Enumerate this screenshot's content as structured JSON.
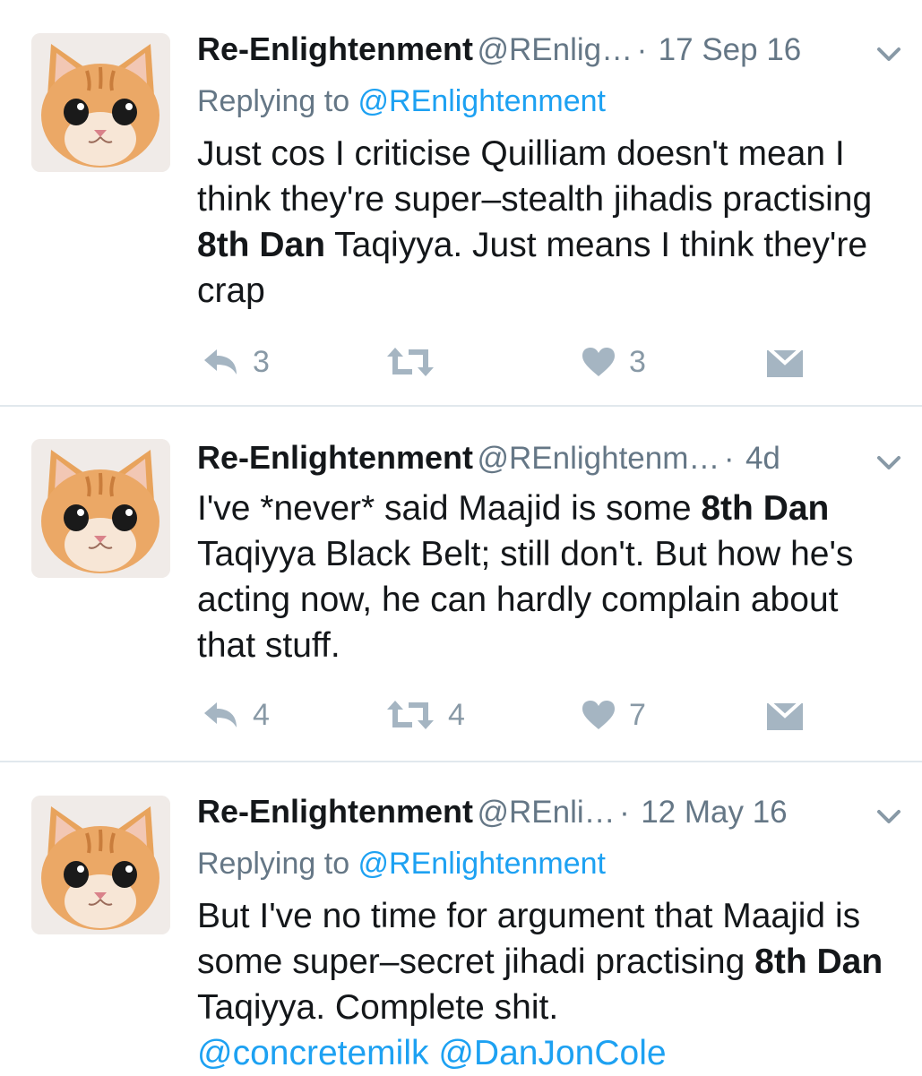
{
  "tweets": [
    {
      "name": "Re-Enlightenment",
      "handle": "@REnlig…",
      "dot": "·",
      "time": "17 Sep 16",
      "replying_prefix": "Replying to ",
      "replying_handle": "@REnlightenment",
      "text": {
        "part1": "Just cos I criticise Quilliam doesn't mean I think they're super–stealth jihadis practising ",
        "bold1": "8th Dan",
        "part2": " Taqiyya. Just means I think they're crap"
      },
      "counts": {
        "reply": "3",
        "retweet": "",
        "like": "3"
      }
    },
    {
      "name": "Re-Enlightenment",
      "handle": "@REnlightenm…",
      "dot": "·",
      "time": "4d",
      "text": {
        "part1": "I've *never* said Maajid is some ",
        "bold1": "8th Dan",
        "part2": " Taqiyya Black Belt; still don't. But how he's acting now, he can hardly complain about that stuff."
      },
      "counts": {
        "reply": "4",
        "retweet": "4",
        "like": "7"
      }
    },
    {
      "name": "Re-Enlightenment",
      "handle": "@REnli…",
      "dot": "·",
      "time": "12 May 16",
      "replying_prefix": "Replying to ",
      "replying_handle": "@REnlightenment",
      "text": {
        "part1": "But I've no time for argument that Maajid is some super–secret jihadi practising ",
        "bold1": "8th Dan",
        "part2": " Taqiyya. Complete shit.",
        "mention1": "@concretemilk",
        "mention2": "@DanJonCole"
      }
    }
  ],
  "icons": {
    "reply": "reply-arrow-icon",
    "retweet": "retweet-icon",
    "like": "heart-icon",
    "dm": "envelope-icon",
    "menu": "chevron-down-icon",
    "avatar": "kitten-avatar"
  },
  "colors": {
    "name": "#14171a",
    "meta": "#657786",
    "link": "#1da1f2",
    "action_icon": "#a5b5c2",
    "divider": "#e1e8ed"
  }
}
